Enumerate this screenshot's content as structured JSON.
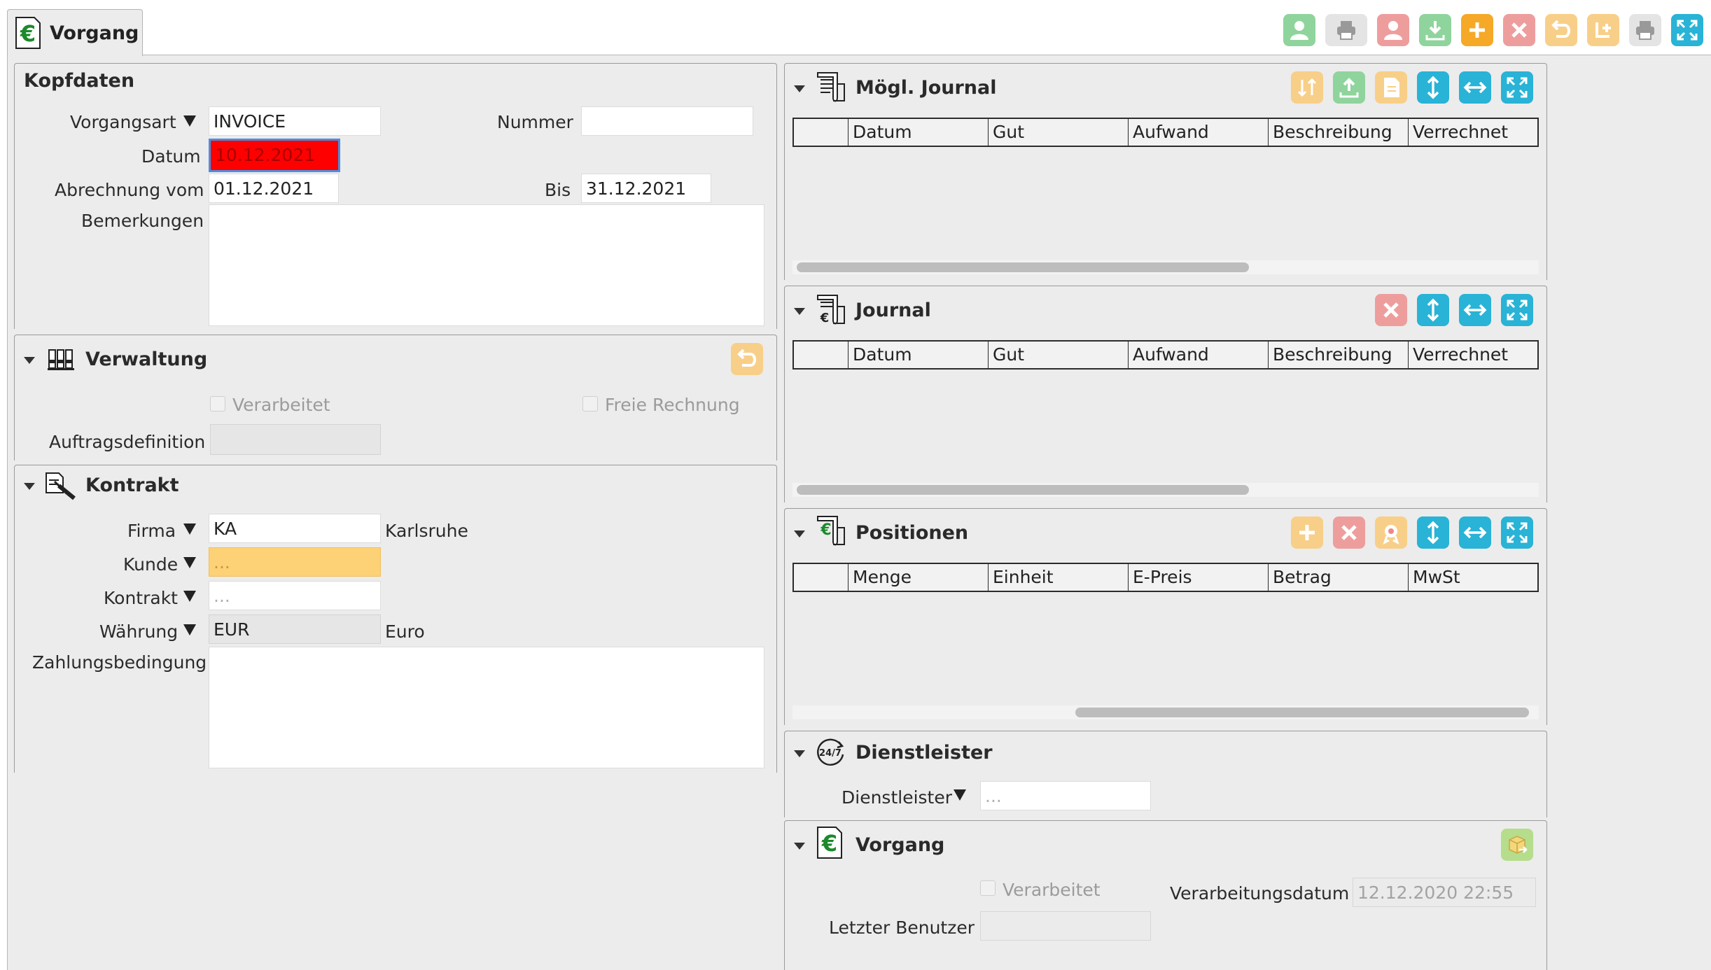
{
  "tab": {
    "title": "Vorgang"
  },
  "colors": {
    "teal": "#29b3d6",
    "green": "#7fcf8e",
    "red": "#ea9e9e",
    "orange": "#f5b13e",
    "lightorange": "#f7cf86",
    "grey": "#aaaaaa",
    "datum_bg": "#ff0000",
    "kunde_bg": "#fdd175"
  },
  "toolbar_icons": [
    "user-add-icon",
    "print-menu-icon",
    "user-remove-icon",
    "download-icon",
    "add-icon",
    "delete-icon",
    "undo-icon",
    "add-child-icon",
    "print-icon",
    "fullscreen-icon"
  ],
  "kopfdaten": {
    "title": "Kopfdaten",
    "vorgangsart_label": "Vorgangsart",
    "vorgangsart_value": "INVOICE",
    "nummer_label": "Nummer",
    "nummer_value": "",
    "datum_label": "Datum",
    "datum_value": "10.12.2021",
    "abrechnung_label": "Abrechnung vom",
    "abrechnung_value": "01.12.2021",
    "bis_label": "Bis",
    "bis_value": "31.12.2021",
    "bemerkungen_label": "Bemerkungen"
  },
  "verwaltung": {
    "title": "Verwaltung",
    "verarbeitet_label": "Verarbeitet",
    "freie_rechnung_label": "Freie Rechnung",
    "auftragsdefinition_label": "Auftragsdefinition"
  },
  "kontrakt": {
    "title": "Kontrakt",
    "firma_label": "Firma",
    "firma_value": "KA",
    "firma_name": "Karlsruhe",
    "kunde_label": "Kunde",
    "kunde_value": "...",
    "kontrakt_label": "Kontrakt",
    "kontrakt_value": "...",
    "waehrung_label": "Währung",
    "waehrung_value": "EUR",
    "waehrung_name": "Euro",
    "zahlungsbedingung_label": "Zahlungsbedingung"
  },
  "moegl_journal": {
    "title": "Mögl. Journal",
    "columns": [
      "",
      "Datum",
      "Gut",
      "Aufwand",
      "Beschreibung",
      "Verrechnet"
    ]
  },
  "journal": {
    "title": "Journal",
    "columns": [
      "",
      "Datum",
      "Gut",
      "Aufwand",
      "Beschreibung",
      "Verrechnet"
    ]
  },
  "positionen": {
    "title": "Positionen",
    "columns": [
      "",
      "Menge",
      "Einheit",
      "E-Preis",
      "Betrag",
      "MwSt"
    ]
  },
  "dienstleister": {
    "title": "Dienstleister",
    "field_label": "Dienstleister",
    "field_value": "..."
  },
  "vorgang": {
    "title": "Vorgang",
    "verarbeitet_label": "Verarbeitet",
    "verarbeitungsdatum_label": "Verarbeitungsdatum",
    "verarbeitungsdatum_value": "12.12.2020 22:55",
    "letzter_benutzer_label": "Letzter Benutzer",
    "letzter_benutzer_value": ""
  }
}
